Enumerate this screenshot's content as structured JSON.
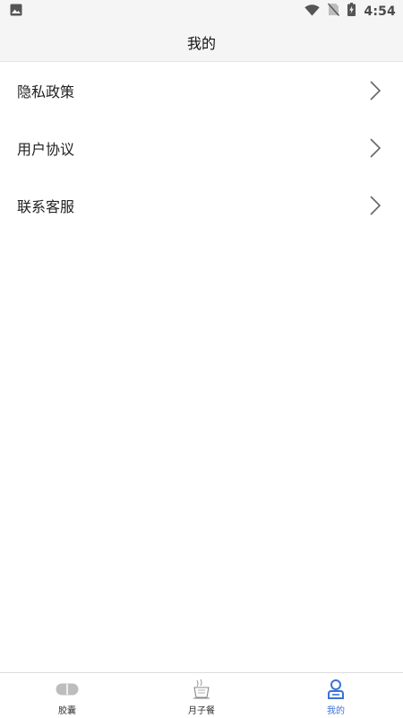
{
  "status_bar": {
    "time": "4:54",
    "icons": [
      "image-icon",
      "wifi-icon",
      "no-sim-icon",
      "battery-charging-icon"
    ]
  },
  "header": {
    "title": "我的"
  },
  "menu": {
    "items": [
      {
        "label": "隐私政策",
        "icon": "chevron-right-icon"
      },
      {
        "label": "用户协议",
        "icon": "chevron-right-icon"
      },
      {
        "label": "联系客服",
        "icon": "chevron-right-icon"
      }
    ]
  },
  "tabbar": {
    "active_color": "#3b73d9",
    "items": [
      {
        "label": "胶囊",
        "icon": "capsule-icon"
      },
      {
        "label": "月子餐",
        "icon": "meal-icon"
      },
      {
        "label": "我的",
        "icon": "user-icon",
        "active": true
      }
    ]
  }
}
